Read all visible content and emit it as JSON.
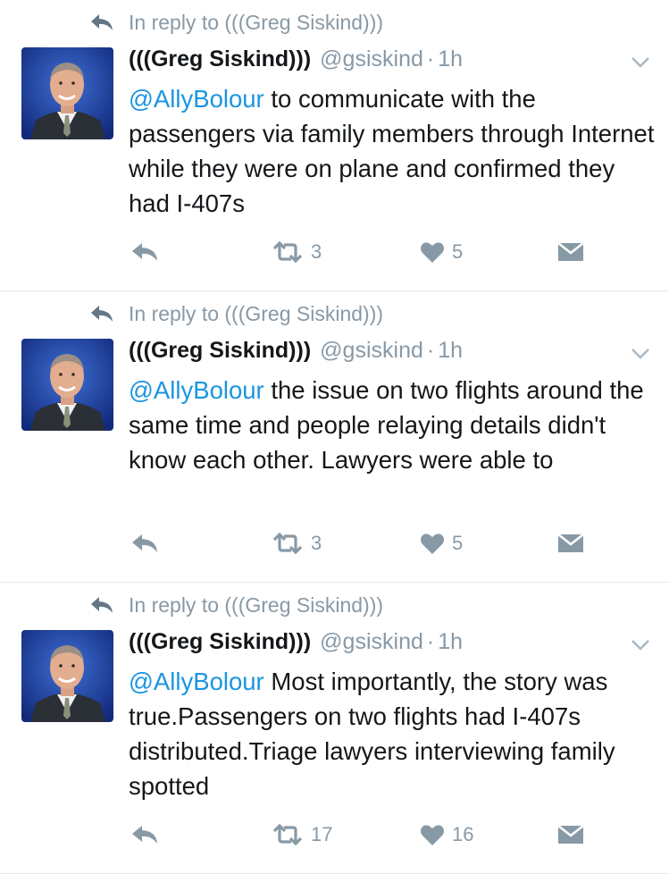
{
  "colors": {
    "accent": "#1b95e0",
    "muted": "#8899a6",
    "text": "#14171a",
    "divider": "#e1e8ed"
  },
  "tweets": [
    {
      "reply_context": "In reply to (((Greg Siskind)))",
      "name": "(((Greg Siskind)))",
      "handle": "@gsiskind",
      "dot": "·",
      "time": "1h",
      "mention": "@AllyBolour",
      "text": " to communicate with the passengers via family members through Internet while they were on plane and confirmed they had I-407s",
      "retweets": "3",
      "likes": "5"
    },
    {
      "reply_context": "In reply to (((Greg Siskind)))",
      "name": "(((Greg Siskind)))",
      "handle": "@gsiskind",
      "dot": "·",
      "time": "1h",
      "mention": "@AllyBolour",
      "text": " the issue on two flights around the same time and people relaying details didn't know each other. Lawyers were able to",
      "retweets": "3",
      "likes": "5"
    },
    {
      "reply_context": "In reply to (((Greg Siskind)))",
      "name": "(((Greg Siskind)))",
      "handle": "@gsiskind",
      "dot": "·",
      "time": "1h",
      "mention": "@AllyBolour",
      "text": " Most importantly, the story was true.Passengers on two flights had I-407s distributed.Triage lawyers interviewing family spotted",
      "retweets": "17",
      "likes": "16"
    }
  ]
}
